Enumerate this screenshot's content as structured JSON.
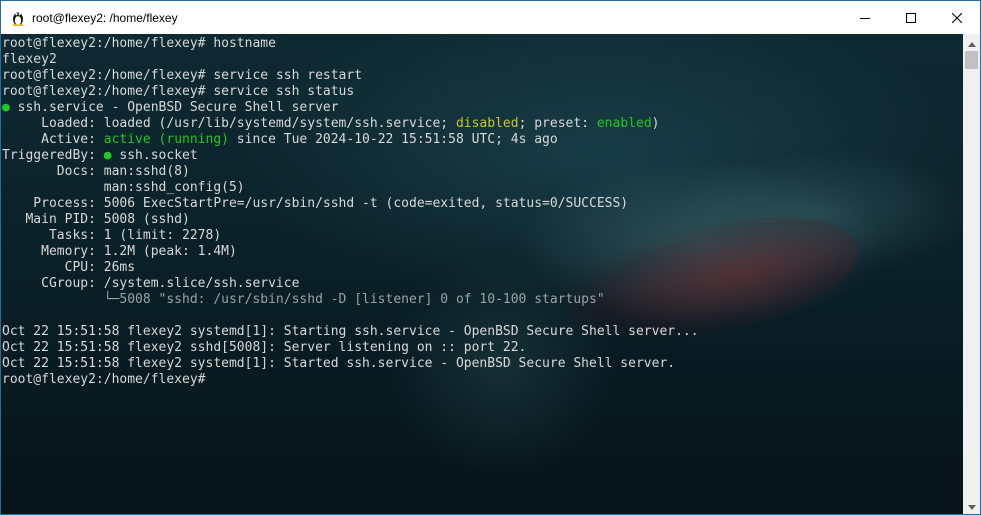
{
  "window": {
    "title": "root@flexey2: /home/flexey",
    "icons": {
      "app": "tux-penguin-icon",
      "minimize": "minimize-icon",
      "maximize": "maximize-icon",
      "close": "close-icon"
    }
  },
  "terminal": {
    "lines": [
      [
        {
          "text": "root@flexey2:/home/flexey# hostname"
        }
      ],
      [
        {
          "text": "flexey2"
        }
      ],
      [
        {
          "text": "root@flexey2:/home/flexey# service ssh restart"
        }
      ],
      [
        {
          "text": "root@flexey2:/home/flexey# service ssh status"
        }
      ],
      [
        {
          "text": "●",
          "color": "green"
        },
        {
          "text": " ssh.service - OpenBSD Secure Shell server"
        }
      ],
      [
        {
          "text": "     Loaded: loaded (/usr/lib/systemd/system/ssh.service; "
        },
        {
          "text": "disabled",
          "color": "yellow"
        },
        {
          "text": "; preset: "
        },
        {
          "text": "enabled",
          "color": "green"
        },
        {
          "text": ")"
        }
      ],
      [
        {
          "text": "     Active: "
        },
        {
          "text": "active (running)",
          "color": "green"
        },
        {
          "text": " since Tue 2024-10-22 15:51:58 UTC; 4s ago"
        }
      ],
      [
        {
          "text": "TriggeredBy: "
        },
        {
          "text": "●",
          "color": "green"
        },
        {
          "text": " ssh.socket"
        }
      ],
      [
        {
          "text": "       Docs: man:sshd(8)"
        }
      ],
      [
        {
          "text": "             man:sshd_config(5)"
        }
      ],
      [
        {
          "text": "    Process: 5006 ExecStartPre=/usr/sbin/sshd -t (code=exited, status=0/SUCCESS)"
        }
      ],
      [
        {
          "text": "   Main PID: 5008 (sshd)"
        }
      ],
      [
        {
          "text": "      Tasks: 1 (limit: 2278)"
        }
      ],
      [
        {
          "text": "     Memory: 1.2M (peak: 1.4M)"
        }
      ],
      [
        {
          "text": "        CPU: 26ms"
        }
      ],
      [
        {
          "text": "     CGroup: /system.slice/ssh.service"
        }
      ],
      [
        {
          "text": "             └─5008 \"sshd: /usr/sbin/sshd -D [listener] 0 of 10-100 startups\"",
          "color": "dim"
        }
      ],
      [
        {
          "text": ""
        }
      ],
      [
        {
          "text": "Oct 22 15:51:58 flexey2 systemd[1]: Starting ssh.service - OpenBSD Secure Shell server..."
        }
      ],
      [
        {
          "text": "Oct 22 15:51:58 flexey2 sshd[5008]: Server listening on :: port 22."
        }
      ],
      [
        {
          "text": "Oct 22 15:51:58 flexey2 systemd[1]: Started ssh.service - OpenBSD Secure Shell server."
        }
      ],
      [
        {
          "text": "root@flexey2:/home/flexey# "
        }
      ]
    ]
  },
  "scrollbar": {
    "icons": {
      "up": "scroll-up-arrow-icon",
      "down": "scroll-down-arrow-icon"
    }
  }
}
